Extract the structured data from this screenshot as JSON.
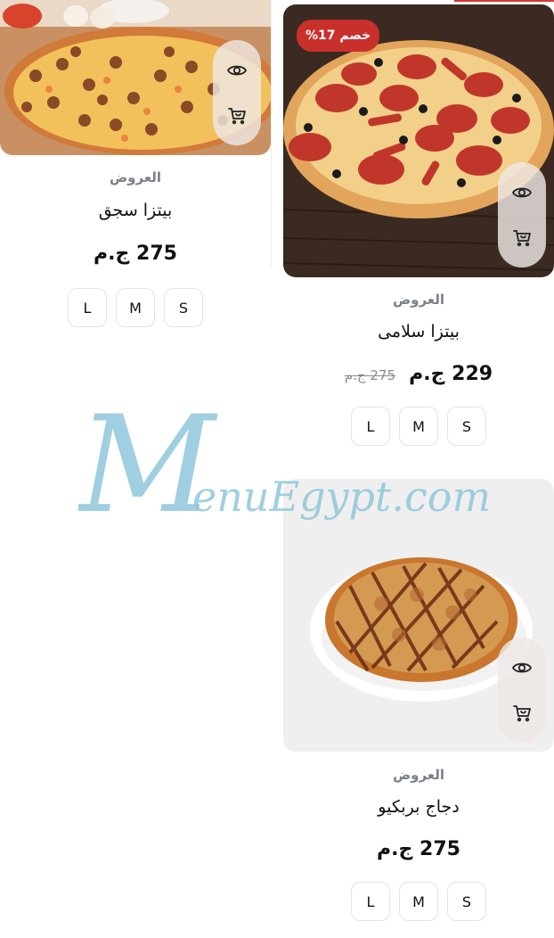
{
  "currency_suffix": "ج.م",
  "products": [
    {
      "id": "salami",
      "category": "العروض",
      "name": "بيتزا سلامى",
      "price": "229 ج.م",
      "old_price": "275 ج.م",
      "discount_badge": "خصم 17%",
      "sizes": [
        "S",
        "M",
        "L"
      ],
      "image_icon": "pepperoni-pizza"
    },
    {
      "id": "sausage",
      "category": "العروض",
      "name": "بيتزا سجق",
      "price": "275 ج.م",
      "sizes": [
        "S",
        "M",
        "L"
      ],
      "image_icon": "sausage-pizza"
    },
    {
      "id": "bbq-chicken",
      "category": "العروض",
      "name": "دجاج بربكيو",
      "price": "275 ج.م",
      "sizes": [
        "S",
        "M",
        "L"
      ],
      "image_icon": "bbq-chicken-pizza"
    }
  ],
  "actions": {
    "view_icon": "eye-icon",
    "cart_icon": "cart-icon"
  },
  "watermark": "MenuEgypt.com",
  "colors": {
    "badge": "#c9302c",
    "category_text": "#7c8088",
    "watermark": "#8fc7db"
  }
}
